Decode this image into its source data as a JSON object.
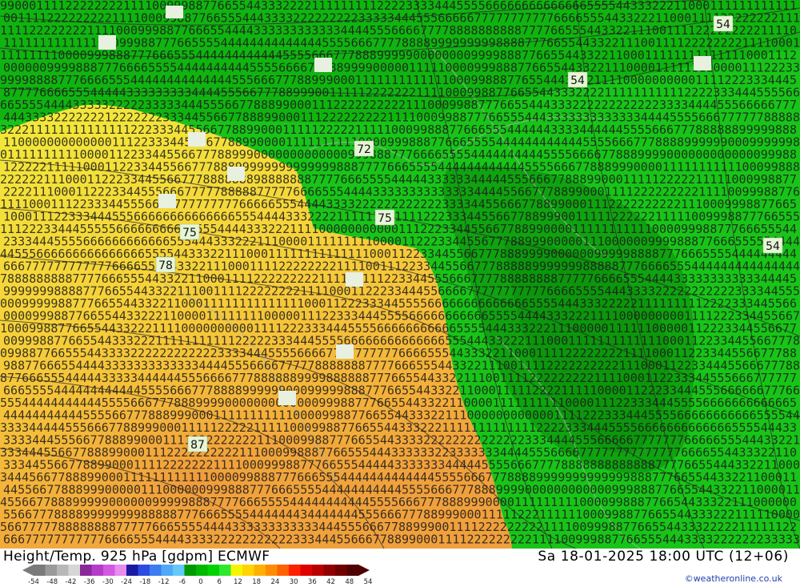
{
  "title": "Height/Temp. 925 hPa [gdpm] ECMWF",
  "valid_time": "Sa 18-01-2025 18:00 UTC (12+06)",
  "credit": "©weatheronline.co.uk",
  "scale": {
    "tick_labels": [
      "-54",
      "-48",
      "-42",
      "-36",
      "-30",
      "-24",
      "-18",
      "-12",
      "-6",
      "0",
      "6",
      "12",
      "18",
      "24",
      "30",
      "36",
      "42",
      "48",
      "54"
    ],
    "colors": [
      "#7a7a7a",
      "#9a9a9a",
      "#b8b8b8",
      "#d6d6d6",
      "#8a2a9a",
      "#b43cc8",
      "#d25ae0",
      "#e88cf0",
      "#1a1aa0",
      "#2c4ce0",
      "#3c7cf0",
      "#50a8f8",
      "#64c8f8",
      "#009a00",
      "#00b800",
      "#00d200",
      "#2ee82e",
      "#f5f500",
      "#ffd400",
      "#ffb000",
      "#ff8c00",
      "#ff6000",
      "#ff2000",
      "#e00000",
      "#b80000",
      "#900000",
      "#700000",
      "#500000"
    ]
  },
  "contour_labels": [
    {
      "text": "54"
    },
    {
      "text": "54"
    },
    {
      "text": "54"
    },
    {
      "text": "72"
    },
    {
      "text": "75"
    },
    {
      "text": "75"
    },
    {
      "text": "78"
    },
    {
      "text": "87"
    }
  ]
}
